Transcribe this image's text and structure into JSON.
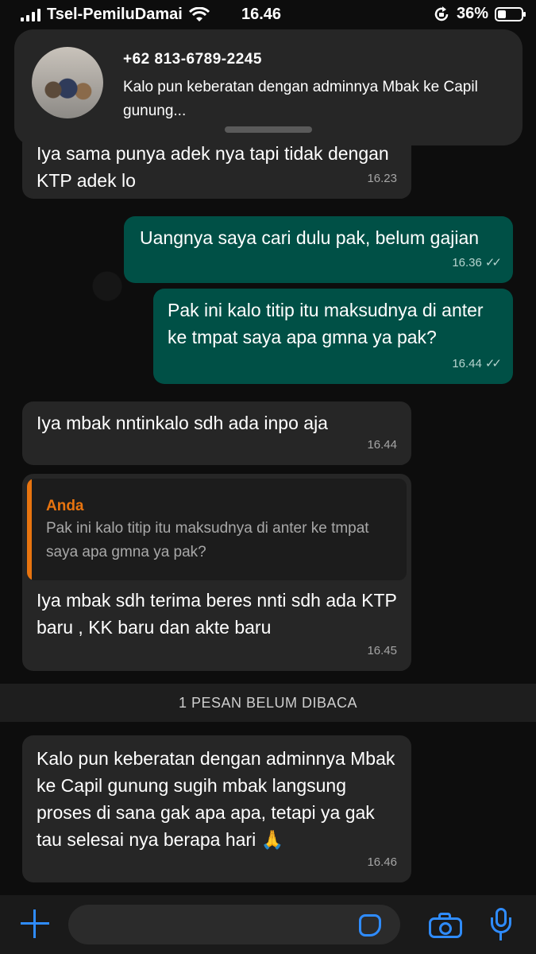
{
  "status_bar": {
    "carrier": "Tsel-PemiluDamai",
    "time": "16.46",
    "battery_percent": "36%",
    "battery_level": 0.36
  },
  "notification": {
    "sender": "+62 813-6789-2245",
    "preview": "Kalo pun keberatan dengan adminnya Mbak ke Capil gunung..."
  },
  "messages": [
    {
      "direction": "in",
      "text": "Iya sama punya adek nya tapi tidak dengan KTP adek lo",
      "time": "16.23"
    },
    {
      "direction": "out",
      "text": "Uangnya saya cari dulu pak, belum gajian",
      "time": "16.36",
      "status": "read"
    },
    {
      "direction": "out",
      "text": "Pak ini kalo titip itu maksudnya di anter ke tmpat saya apa gmna ya pak?",
      "time": "16.44",
      "status": "read"
    },
    {
      "direction": "in",
      "text": "Iya mbak nntinkalo sdh ada inpo aja",
      "time": "16.44"
    },
    {
      "direction": "in",
      "quote_author": "Anda",
      "quote_text": "Pak ini kalo titip itu maksudnya di anter ke tmpat saya apa gmna ya pak?",
      "text": "Iya mbak sdh terima beres nnti sdh ada KTP baru , KK baru dan akte baru",
      "time": "16.45"
    },
    {
      "direction": "in",
      "text": "Kalo pun keberatan dengan adminnya Mbak ke Capil gunung sugih mbak langsung proses di sana gak apa apa, tetapi ya gak tau selesai nya berapa hari 🙏",
      "time": "16.46"
    }
  ],
  "unread_divider": "1 PESAN BELUM DIBACA",
  "composer": {
    "value": ""
  },
  "icons": [
    "wifi-icon",
    "orientation-lock-icon",
    "battery-icon",
    "plus-icon",
    "sticker-icon",
    "camera-icon",
    "mic-icon",
    "read-ticks-icon"
  ],
  "colors": {
    "incoming_bubble": "#262626",
    "outgoing_bubble": "#005046",
    "quote_accent": "#e8740f",
    "action_blue": "#2f8cff"
  }
}
